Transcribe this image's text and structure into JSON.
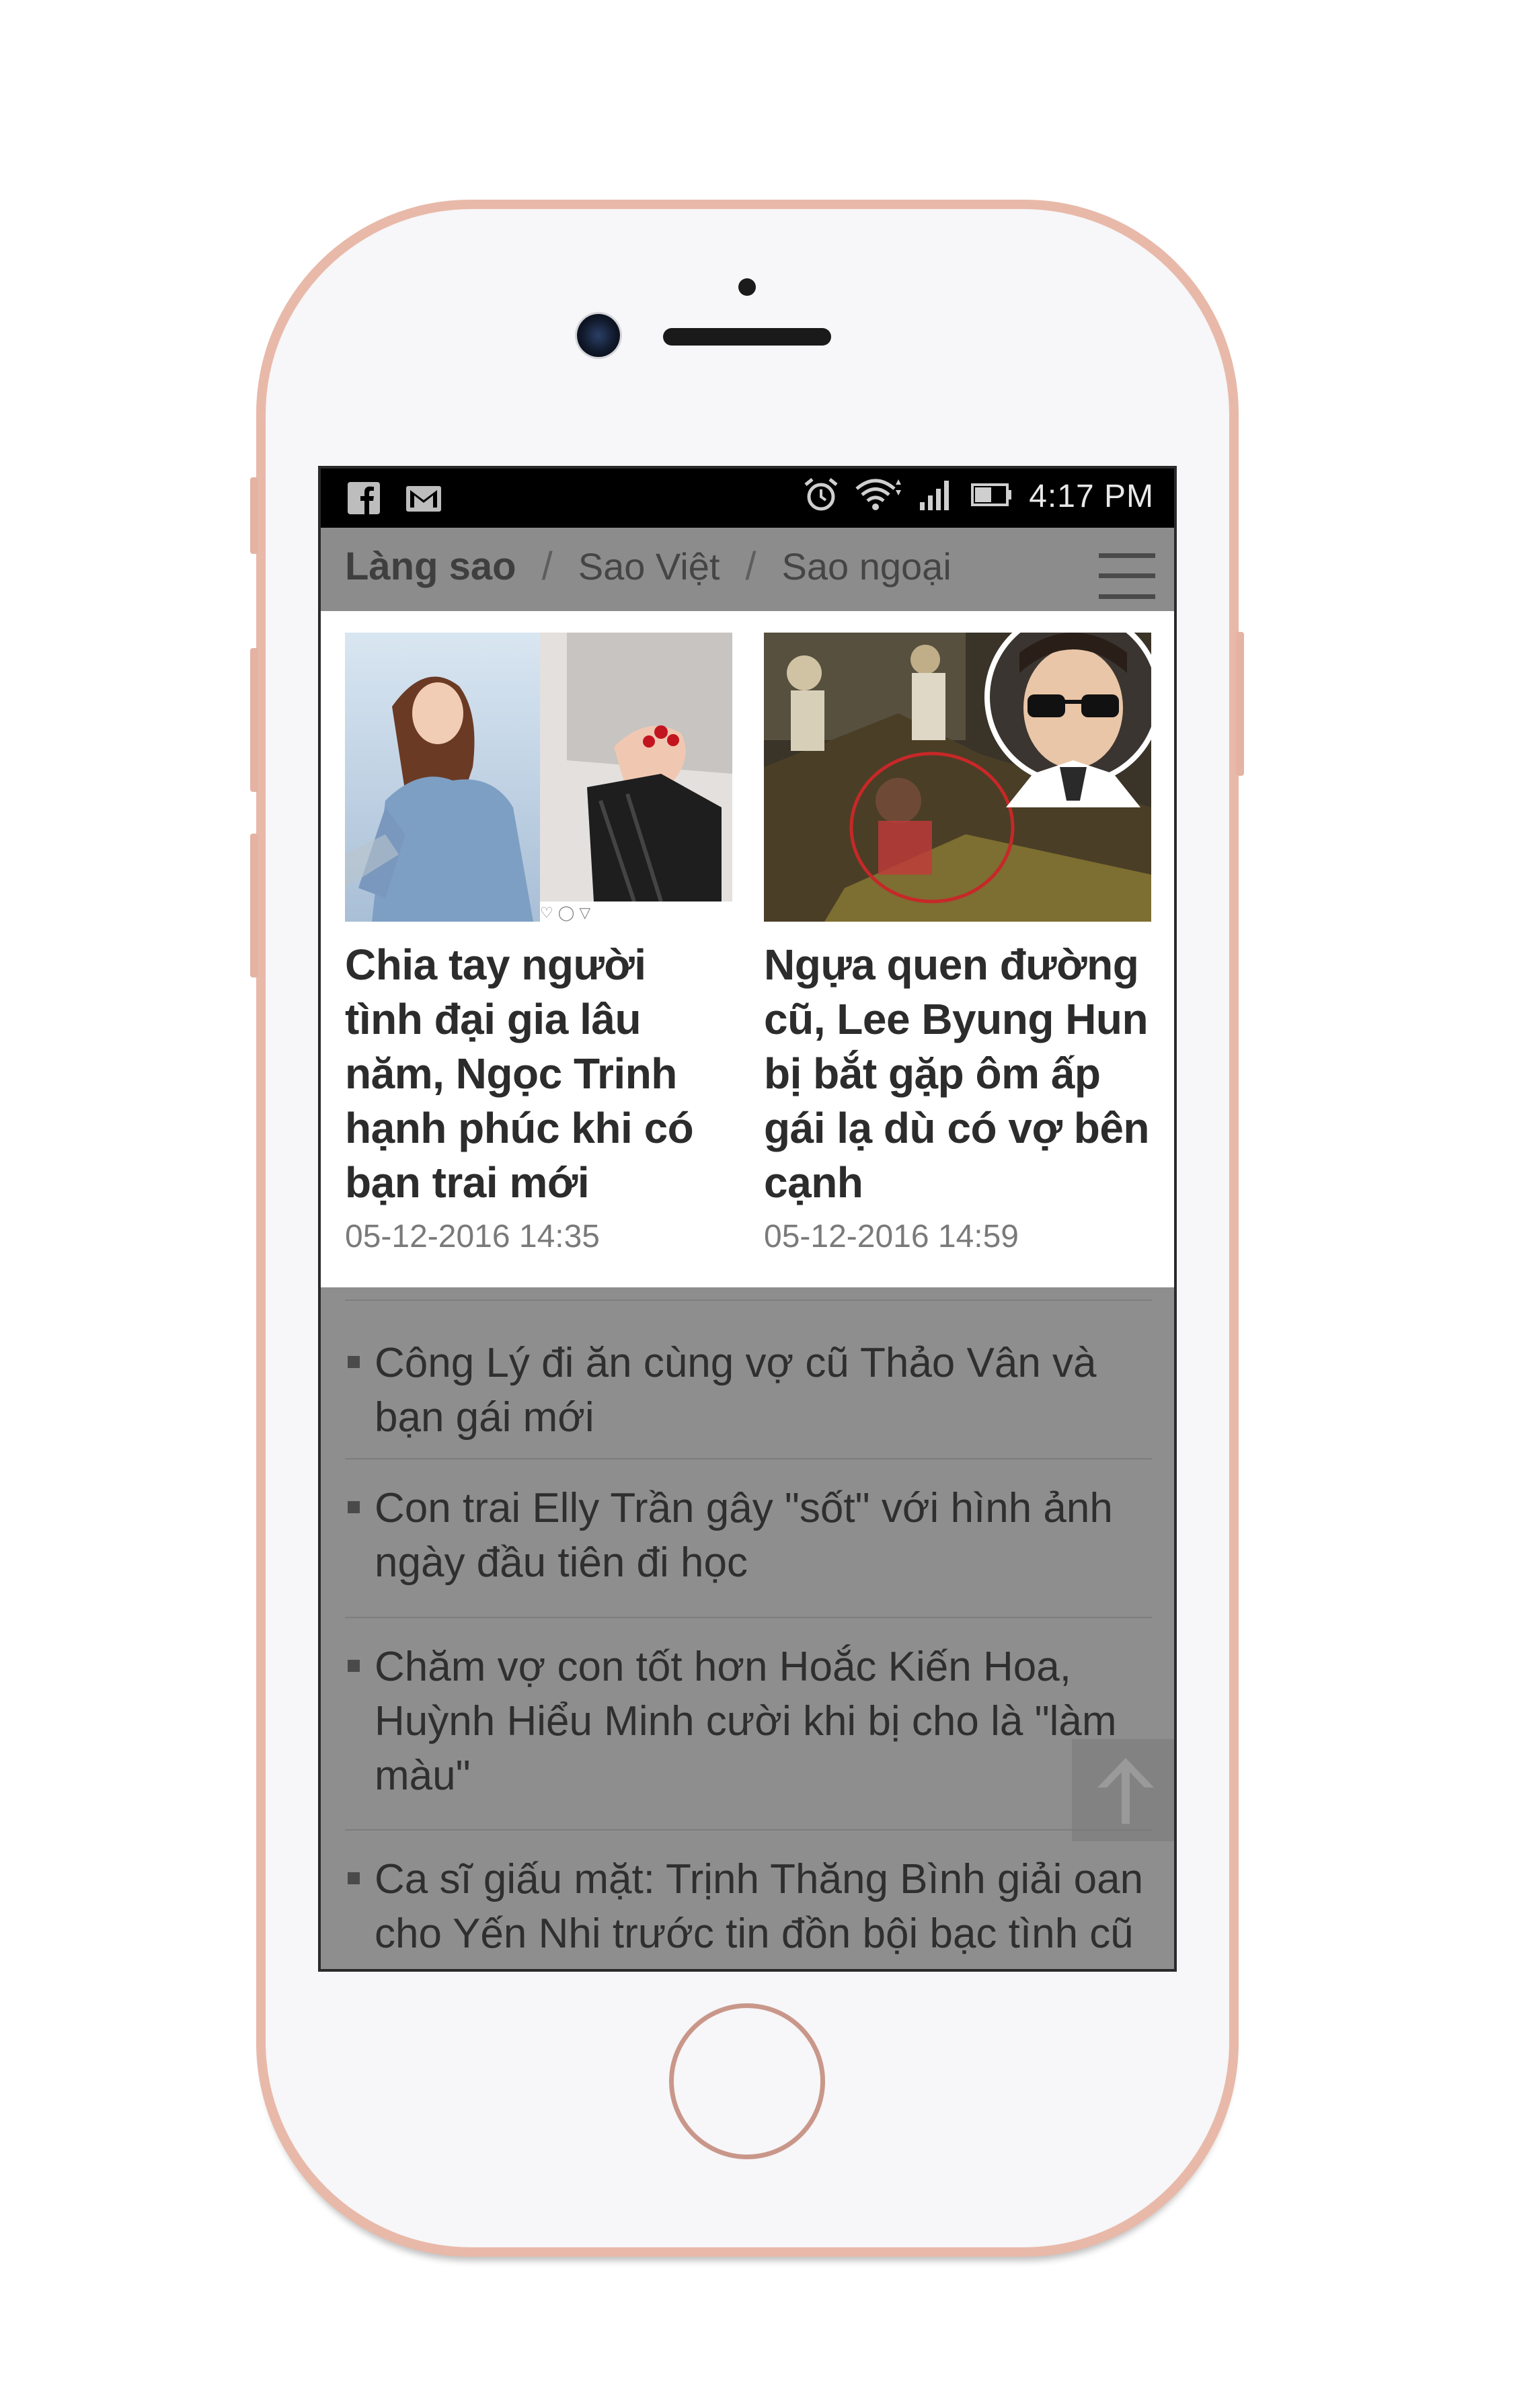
{
  "status_bar": {
    "left_icons": [
      "facebook-icon",
      "gmail-icon"
    ],
    "right_icons": [
      "alarm-icon",
      "wifi-icon",
      "signal-icon",
      "battery-icon"
    ],
    "time": "4:17 PM"
  },
  "nav": {
    "items": [
      {
        "label": "Làng sao",
        "active": true
      },
      {
        "label": "Sao Việt",
        "active": false
      },
      {
        "label": "Sao ngoại",
        "active": false
      }
    ],
    "separator": "/",
    "menu_icon": "hamburger-menu-icon"
  },
  "featured": [
    {
      "title": "Chia tay người tình đại gia lâu năm, Ngọc Trinh hạnh phúc khi có bạn trai mới",
      "date": "05-12-2016 14:35"
    },
    {
      "title": "Ngựa quen đường cũ, Lee Byung Hun bị bắt gặp ôm ấp gái lạ dù có vợ bên cạnh",
      "date": "05-12-2016 14:59"
    }
  ],
  "list": [
    {
      "text": "Công Lý đi ăn cùng vợ cũ Thảo Vân và bạn gái mới"
    },
    {
      "text": "Con trai Elly Trần gây \"sốt\" với hình ảnh ngày đầu tiên đi học"
    },
    {
      "text": "Chăm vợ con tốt hơn Hoắc Kiến Hoa, Huỳnh Hiểu Minh cười khi bị cho là \"làm màu\""
    },
    {
      "text": "Ca sĩ giấu mặt: Trịnh Thăng Bình giải oan cho Yến Nhi trước tin đồn bội bạc tình cũ"
    }
  ],
  "scroll_top_icon": "arrow-up-icon",
  "colors": {
    "phone_frame": "#e8b9a9",
    "nav_bg": "#8c8c8c",
    "list_bg": "#8e8e8e",
    "status_bar_bg": "#000000"
  }
}
